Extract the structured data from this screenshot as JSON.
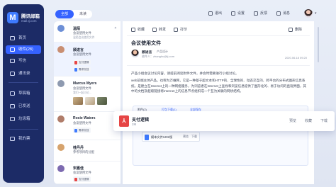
{
  "brand": {
    "name": "腾讯邮箱",
    "domain": "mail.tj.com",
    "logo_letter": "M"
  },
  "nav": [
    {
      "label": "首页",
      "icon": "home-icon"
    },
    {
      "label": "收件(28)",
      "icon": "inbox-icon",
      "active": true
    },
    {
      "label": "写信",
      "icon": "compose-icon"
    },
    {
      "label": "通讯录",
      "icon": "contacts-icon"
    },
    {
      "label": "草稿箱",
      "icon": "draft-icon"
    },
    {
      "label": "已发送",
      "icon": "sent-icon"
    },
    {
      "label": "垃圾箱",
      "icon": "trash-icon"
    },
    {
      "label": "我的票",
      "icon": "ticket-icon"
    }
  ],
  "topbar": {
    "tabs": [
      {
        "label": "全部",
        "active": true
      },
      {
        "label": "未读"
      }
    ],
    "actions": [
      "退出",
      "设置",
      "反馈",
      "消息"
    ]
  },
  "mail_list": [
    {
      "name": "温陌",
      "subject": "会议使用文件",
      "preview": "温陌会议使用文件",
      "avatar_color": "#6d8fd6"
    },
    {
      "name": "顾进言",
      "subject": "会议使用文件",
      "preview": "",
      "attachments": [
        "支付逻辑",
        "需求文档"
      ],
      "avatar_color": "#c98f72"
    },
    {
      "name": "Marcus Myers",
      "subject": "会议使用文件",
      "preview": "我们一起讨论...",
      "avatar_color": "#8e9ab0"
    },
    {
      "name": "Rosie Waters",
      "subject": "会议使用文件",
      "preview": "",
      "attachments": [
        "需求文档"
      ],
      "avatar_color": "#b07d6a"
    },
    {
      "name": "桂丹丹",
      "subject": "参考项目的分配",
      "preview": "",
      "avatar_color": "#d6a36d"
    },
    {
      "name": "宋嘉佳",
      "subject": "会议使用文件",
      "preview": "",
      "attachments": [
        "支付逻辑"
      ],
      "avatar_color": "#7d6ab0"
    }
  ],
  "reader": {
    "tools": [
      "收藏",
      "转发",
      "打印"
    ],
    "delete_label": "删除",
    "subject": "会议使用文件",
    "sender": "顾进言",
    "sender_tag": "产品设计",
    "to": "收件人：zhanghu@tj.com",
    "date": "2020.06.18 09:20",
    "body": [
      "产品小组会议讨论内容，请提前阅读附件文件，并会时需要进行小组讨论。",
      "web前端主体产品，也称为万维网，它是一种基于超文本和HTTP的、全球性的、动态交互的、跨平台的分布式图形信息系统。是建立在Internet上的一种网络服务，为浏览者在Internet上查找和浏览信息提供了图形化的、易于访问的直观界面，其中的文档及超级链接将Internet上的信息节点组织成一个互为关联的网状结构。"
    ],
    "attachment_bar": {
      "label": "附件(2)",
      "preview_label": "打包下载(1)",
      "save_label": "全部保存"
    },
    "inline_attachment": {
      "name": "模本文件1202版",
      "actions": [
        "预览",
        "下载"
      ]
    }
  },
  "floating_attachment": {
    "name": "支付逻辑",
    "size": "2M",
    "actions": [
      "预览",
      "收藏",
      "下载"
    ]
  }
}
